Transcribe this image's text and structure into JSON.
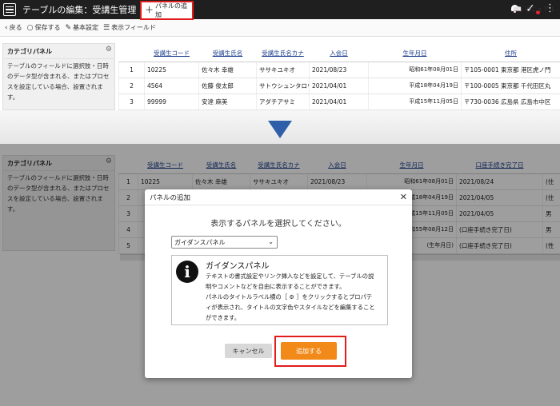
{
  "app": {
    "title": "テーブルの編集：受講生管理"
  },
  "toolbar": {
    "back": "戻る",
    "save": "保存する",
    "basic": "基本設定",
    "fields": "表示フィールド",
    "add_panel": "パネルの追加",
    "manual": "マニュアル"
  },
  "category_panel": {
    "title": "カテゴリパネル",
    "text": [
      "テーブルのフィールドに選択肢・日時",
      "のデータ型が含まれる、またはプロセ",
      "スを設定している場合、設置されま",
      "す。"
    ]
  },
  "upper_table": {
    "headers": [
      "受講生コード",
      "受講生氏名",
      "受講生氏名カナ",
      "入会日",
      "生年月日",
      "住所"
    ],
    "rows": [
      [
        "1",
        "10225",
        "佐々木 幸雄",
        "ササキユキオ",
        "2021/08/23",
        "昭和61年08月01日",
        "〒105-0001 東京都 港区虎ノ門"
      ],
      [
        "2",
        "4564",
        "佐藤 俊太郎",
        "サトウシュンタロウ",
        "2021/04/01",
        "平成18年04月19日",
        "〒100-0005 東京都 千代田区丸"
      ],
      [
        "3",
        "99999",
        "安達 麻美",
        "アダチアサミ",
        "2021/04/01",
        "平成15年11月05日",
        "〒730-0036 広島県 広島市中区"
      ]
    ]
  },
  "lower_table": {
    "headers": [
      "受講生コード",
      "受講生氏名",
      "受講生氏名カナ",
      "入会日",
      "生年月日",
      "口座手続き完了日"
    ],
    "rows": [
      [
        "1",
        "10225",
        "佐々木 幸雄",
        "ササキユキオ",
        "2021/08/23",
        "昭和61年08月01日",
        "2021/08/24",
        "(住"
      ],
      [
        "2",
        "",
        "",
        "",
        "",
        "平成18年04月19日",
        "2021/04/05",
        "(住"
      ],
      [
        "3",
        "",
        "",
        "",
        "",
        "平成15年11月05日",
        "2021/04/05",
        "男"
      ],
      [
        "4",
        "",
        "",
        "",
        "",
        "昭和55年08月12日",
        "(口座手続き完了日)",
        "男"
      ],
      [
        "5",
        "",
        "",
        "",
        "",
        "(生年月日)",
        "(口座手続き完了日)",
        "(性"
      ]
    ]
  },
  "modal": {
    "title": "パネルの追加",
    "prompt": "表示するパネルを選択してください。",
    "selected": "ガイダンスパネル",
    "guidance_title": "ガイダンスパネル",
    "guidance_text": [
      "テキストの書式設定やリンク挿入などを設定して、テーブルの説",
      "明やコメントなどを自由に表示することができます。",
      "パネルのタイトルラベル横の［ ⚙ ］をクリックするとプロパテ",
      "ィが表示され、タイトルの文字色やスタイルなどを編集すること",
      "ができます。"
    ],
    "cancel": "キャンセル",
    "add": "追加する"
  },
  "colors": {
    "highlight": "#e21b1b",
    "add_button": "#f28a1a",
    "arrow": "#2f5fa8"
  }
}
